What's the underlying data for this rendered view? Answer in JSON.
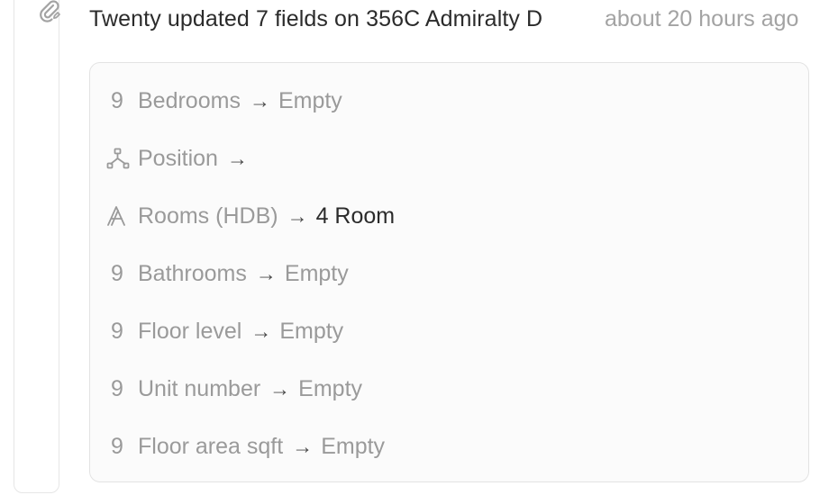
{
  "activity": {
    "header_text": "Twenty updated 7 fields on 356C Admiralty D",
    "time": "about 20 hours ago",
    "rail_icon": "paperclip-edit-icon"
  },
  "changes": [
    {
      "icon": "number-icon",
      "icon_glyph": "9",
      "field": "Bedrooms",
      "arrow": "→",
      "value": "Empty",
      "value_empty": true
    },
    {
      "icon": "relation-icon",
      "icon_glyph": "",
      "field": "Position",
      "arrow": "→",
      "value": "",
      "value_empty": true
    },
    {
      "icon": "select-icon",
      "icon_glyph": "",
      "field": "Rooms (HDB)",
      "arrow": "→",
      "value": "4 Room",
      "value_empty": false
    },
    {
      "icon": "number-icon",
      "icon_glyph": "9",
      "field": "Bathrooms",
      "arrow": "→",
      "value": "Empty",
      "value_empty": true
    },
    {
      "icon": "number-icon",
      "icon_glyph": "9",
      "field": "Floor level",
      "arrow": "→",
      "value": "Empty",
      "value_empty": true
    },
    {
      "icon": "number-icon",
      "icon_glyph": "9",
      "field": "Unit number",
      "arrow": "→",
      "value": "Empty",
      "value_empty": true
    },
    {
      "icon": "number-icon",
      "icon_glyph": "9",
      "field": "Floor area sqft",
      "arrow": "→",
      "value": "Empty",
      "value_empty": true
    }
  ]
}
